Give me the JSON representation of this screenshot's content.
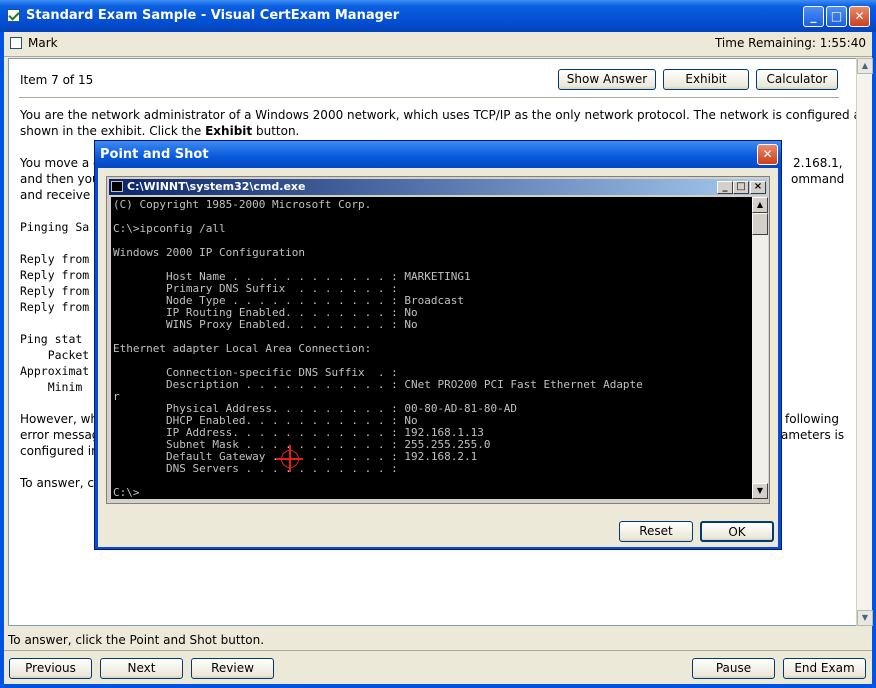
{
  "window": {
    "title": "Standard Exam Sample - Visual CertExam Manager",
    "minimize": "_",
    "maximize": "□",
    "close": "✕"
  },
  "markbar": {
    "mark_label": "Mark",
    "time_remaining": "Time Remaining: 1:55:40"
  },
  "question": {
    "item_label": "Item 7 of 15",
    "buttons": {
      "show_answer": "Show Answer",
      "exhibit": "Exhibit",
      "calculator": "Calculator"
    },
    "para1_line1": "You are the network administrator of a Windows 2000 network, which uses TCP/IP as the only network protocol. The network is configured as",
    "para1_line2_pre": "shown in the exhibit. Click the ",
    "para1_line2_bold": "Exhibit",
    "para1_line2_post": " button.",
    "para2_line1_left": "You move a c",
    "para2_line1_right": "2.168.1,",
    "para2_line2_left": "and then you",
    "para2_line2_right": "ommand",
    "para2_line3_left": "and receive t",
    "ping_line": "Pinging Sa",
    "reply_lines": [
      "Reply from",
      "Reply from",
      "Reply from",
      "Reply from"
    ],
    "stat_lines": [
      "Ping stat",
      "    Packet",
      "Approximat",
      "    Minim"
    ],
    "para3_line1_left": "However, whe",
    "para3_line1_right": "following",
    "para3_line2_left": "error messag",
    "para3_line2_right": "ameters is",
    "para3_line3_left": "configured in",
    "para4_left": "To answer, c"
  },
  "status": {
    "text": "To answer, click the Point and Shot button."
  },
  "footer": {
    "previous": "Previous",
    "next": "Next",
    "review": "Review",
    "pause": "Pause",
    "end_exam": "End Exam"
  },
  "dialog": {
    "title": "Point and Shot",
    "close": "✕",
    "reset": "Reset",
    "ok": "OK",
    "cmd": {
      "title": "C:\\WINNT\\system32\\cmd.exe",
      "lines": [
        "(C) Copyright 1985-2000 Microsoft Corp.",
        "",
        "C:\\>ipconfig /all",
        "",
        "Windows 2000 IP Configuration",
        "",
        "        Host Name . . . . . . . . . . . . : MARKETING1",
        "        Primary DNS Suffix  . . . . . . . :",
        "        Node Type . . . . . . . . . . . . : Broadcast",
        "        IP Routing Enabled. . . . . . . . : No",
        "        WINS Proxy Enabled. . . . . . . . : No",
        "",
        "Ethernet adapter Local Area Connection:",
        "",
        "        Connection-specific DNS Suffix  . :",
        "        Description . . . . . . . . . . . : CNet PRO200 PCI Fast Ethernet Adapte",
        "r",
        "        Physical Address. . . . . . . . . : 00-80-AD-81-80-AD",
        "        DHCP Enabled. . . . . . . . . . . : No",
        "        IP Address. . . . . . . . . . . . : 192.168.1.13",
        "        Subnet Mask . . . . . . . . . . . : 255.255.255.0",
        "        Default Gateway . . . . . . . . . : 192.168.2.1",
        "        DNS Servers . . . . . . . . . . . :",
        "",
        "C:\\>"
      ]
    }
  }
}
